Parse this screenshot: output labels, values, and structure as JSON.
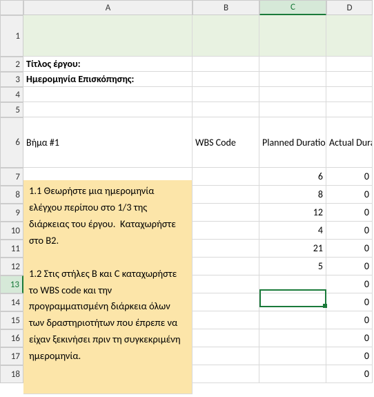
{
  "columns": {
    "rowCorner": "",
    "A": "A",
    "B": "B",
    "C": "C",
    "D": "D"
  },
  "rowLabels": {
    "r1": "1",
    "r2": "2",
    "r3": "3",
    "r4": "4",
    "r5": "5",
    "r6": "6",
    "r7": "7",
    "r8": "8",
    "r9": "9",
    "r10": "10",
    "r11": "11",
    "r12": "12",
    "r13": "13",
    "r14": "14",
    "r15": "15",
    "r16": "16",
    "r17": "17",
    "r18": "18"
  },
  "labels": {
    "projectTitle": "Τίτλος έργου:",
    "reviewDate": "Ημερομηνία Επισκόπησης:",
    "stepHeader": "Βήμα #1",
    "wbsCode": "WBS Code",
    "plannedDuration": "Planned Duration",
    "actualDuration": "Actual Duration"
  },
  "note": "1.1 Θεωρήστε μια ημερομηνία ελέγχου περίπου στο 1/3 της διάρκειας του έργου.  Καταχωρήστε στο B2.\n\n1.2 Στις στήλες B και C καταχωρήστε το WBS code και την προγραμματισμένη διάρκεια όλων των δραστηριοτήτων που έπρεπε να είχαν ξεκινήσει πριν τη συγκεκριμένη ημερομηνία.",
  "chart_data": {
    "type": "table",
    "columns": [
      "WBS Code",
      "Planned Duration",
      "Actual Duration"
    ],
    "rows": [
      [
        "",
        6,
        0
      ],
      [
        "",
        8,
        0
      ],
      [
        "",
        12,
        0
      ],
      [
        "",
        4,
        0
      ],
      [
        "",
        21,
        0
      ],
      [
        "",
        5,
        0
      ],
      [
        "",
        "",
        0
      ],
      [
        "",
        "",
        0
      ],
      [
        "",
        "",
        0
      ],
      [
        "",
        "",
        0
      ],
      [
        "",
        "",
        0
      ],
      [
        "",
        "",
        0
      ]
    ]
  },
  "data": {
    "r7": {
      "C": "6",
      "D": "0"
    },
    "r8": {
      "C": "8",
      "D": "0"
    },
    "r9": {
      "C": "12",
      "D": "0"
    },
    "r10": {
      "C": "4",
      "D": "0"
    },
    "r11": {
      "C": "21",
      "D": "0"
    },
    "r12": {
      "C": "5",
      "D": "0"
    },
    "r13": {
      "C": "",
      "D": "0"
    },
    "r14": {
      "C": "",
      "D": "0"
    },
    "r15": {
      "C": "",
      "D": "0"
    },
    "r16": {
      "C": "",
      "D": "0"
    },
    "r17": {
      "C": "",
      "D": "0"
    },
    "r18": {
      "C": "",
      "D": "0"
    }
  },
  "selection": {
    "cell": "C13"
  }
}
